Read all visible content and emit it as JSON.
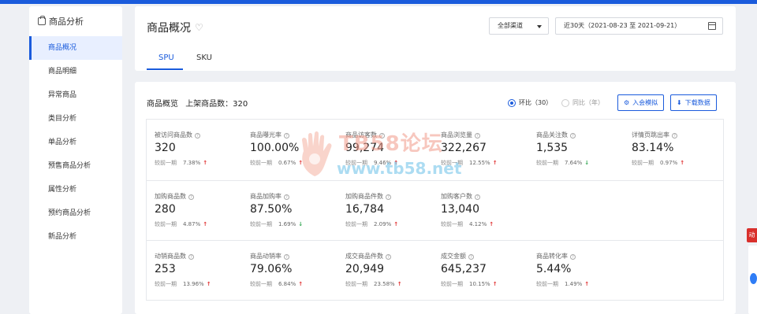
{
  "sidebar": {
    "title": "商品分析",
    "items": [
      {
        "label": "商品概况",
        "active": true
      },
      {
        "label": "商品明细"
      },
      {
        "label": "异常商品"
      },
      {
        "label": "类目分析"
      },
      {
        "label": "单品分析"
      },
      {
        "label": "预售商品分析"
      },
      {
        "label": "属性分析"
      },
      {
        "label": "预约商品分析"
      },
      {
        "label": "新品分析"
      }
    ]
  },
  "header": {
    "title": "商品概况",
    "channel": "全部渠道",
    "date_range": "近30天（2021-08-23 至 2021-09-21）",
    "tabs": [
      {
        "label": "SPU",
        "active": true
      },
      {
        "label": "SKU"
      }
    ]
  },
  "overview": {
    "title": "商品概览",
    "count_label": "上架商品数：320",
    "radio1": "环比（30）",
    "radio2": "同比（年）",
    "btn_add": "入会模拟",
    "btn_download": "下载数据",
    "compare_label": "较前一期",
    "metrics": [
      [
        {
          "label": "被访问商品数",
          "value": "320",
          "pct": "7.38%",
          "trend": "up"
        },
        {
          "label": "商品曝光率",
          "value": "100.00%",
          "pct": "0.67%",
          "trend": "up"
        },
        {
          "label": "商品访客数",
          "value": "99,274",
          "pct": "9.46%",
          "trend": "up"
        },
        {
          "label": "商品浏览量",
          "value": "322,267",
          "pct": "12.55%",
          "trend": "up"
        },
        {
          "label": "商品关注数",
          "value": "1,535",
          "pct": "7.64%",
          "trend": "down"
        },
        {
          "label": "详情页跳出率",
          "value": "83.14%",
          "pct": "0.97%",
          "trend": "up"
        }
      ],
      [
        {
          "label": "加购商品数",
          "value": "280",
          "pct": "4.87%",
          "trend": "up"
        },
        {
          "label": "商品加购率",
          "value": "87.50%",
          "pct": "1.69%",
          "trend": "down"
        },
        {
          "label": "加购商品件数",
          "value": "16,784",
          "pct": "2.09%",
          "trend": "up"
        },
        {
          "label": "加购客户数",
          "value": "13,040",
          "pct": "4.12%",
          "trend": "up"
        }
      ],
      [
        {
          "label": "动销商品数",
          "value": "253",
          "pct": "13.96%",
          "trend": "up"
        },
        {
          "label": "商品动销率",
          "value": "79.06%",
          "pct": "6.84%",
          "trend": "up"
        },
        {
          "label": "成交商品件数",
          "value": "20,949",
          "pct": "23.58%",
          "trend": "up"
        },
        {
          "label": "成交金额",
          "value": "645,237",
          "pct": "10.15%",
          "trend": "up"
        },
        {
          "label": "商品转化率",
          "value": "5.44%",
          "pct": "1.49%",
          "trend": "up"
        }
      ]
    ]
  },
  "float_tag": "动",
  "watermark": {
    "line1": "TB58论坛",
    "line2": "www.tb58.net"
  },
  "colors": {
    "accent": "#1a5bdc",
    "up": "#e03030",
    "down": "#2ea44f"
  }
}
